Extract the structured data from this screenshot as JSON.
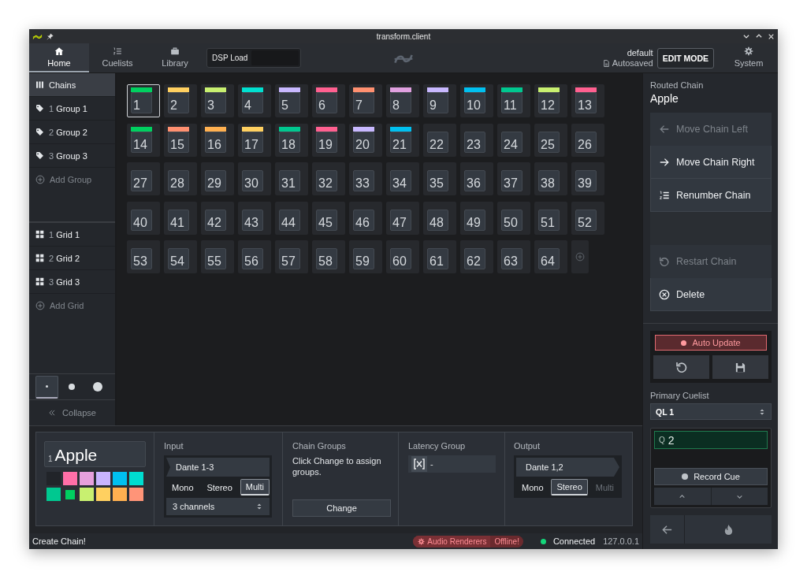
{
  "window": {
    "title": "transform.client"
  },
  "nav_tabs": [
    {
      "label": "Home",
      "selected": true
    },
    {
      "label": "Cuelists",
      "selected": false
    },
    {
      "label": "Library",
      "selected": false
    }
  ],
  "dsp_load": {
    "label": "DSP Load"
  },
  "show": {
    "name": "default",
    "status": "Autosaved"
  },
  "edit_mode_button": "EDIT MODE",
  "system_tab": {
    "label": "System",
    "selected": false
  },
  "sidebar": {
    "chains_item": {
      "label": "Chains",
      "selected": true
    },
    "groups": [
      {
        "number": "1",
        "label": "Group 1",
        "selected": false
      },
      {
        "number": "2",
        "label": "Group 2",
        "selected": false
      },
      {
        "number": "3",
        "label": "Group 3",
        "selected": false
      }
    ],
    "add_group": "Add Group",
    "grids": [
      {
        "number": "1",
        "label": "Grid 1",
        "selected": false
      },
      {
        "number": "2",
        "label": "Grid 2",
        "selected": false
      },
      {
        "number": "3",
        "label": "Grid 3",
        "selected": false
      }
    ],
    "add_grid": "Add Grid",
    "tile_sizes": [
      {
        "selected": true
      },
      {
        "selected": false
      },
      {
        "selected": false
      }
    ],
    "collapse": "Collapse"
  },
  "chains": [
    {
      "number": "1",
      "color": "#00d060",
      "selected": true
    },
    {
      "number": "2",
      "color": "#ffd060",
      "selected": false
    },
    {
      "number": "3",
      "color": "#c8f070",
      "selected": false
    },
    {
      "number": "4",
      "color": "#00e0d0",
      "selected": false
    },
    {
      "number": "5",
      "color": "#c8b8ff",
      "selected": false
    },
    {
      "number": "6",
      "color": "#ff6090",
      "selected": false
    },
    {
      "number": "7",
      "color": "#ff9070",
      "selected": false
    },
    {
      "number": "8",
      "color": "#e0a0e0",
      "selected": false
    },
    {
      "number": "9",
      "color": "#c8b8ff",
      "selected": false
    },
    {
      "number": "10",
      "color": "#00c0f0",
      "selected": false
    },
    {
      "number": "11",
      "color": "#00c890",
      "selected": false
    },
    {
      "number": "12",
      "color": "#c8f070",
      "selected": false
    },
    {
      "number": "13",
      "color": "#ff6090",
      "selected": false
    },
    {
      "number": "14",
      "color": "#00d060",
      "selected": false
    },
    {
      "number": "15",
      "color": "#ff9070",
      "selected": false
    },
    {
      "number": "16",
      "color": "#ffb050",
      "selected": false
    },
    {
      "number": "17",
      "color": "#ffd060",
      "selected": false
    },
    {
      "number": "18",
      "color": "#00c890",
      "selected": false
    },
    {
      "number": "19",
      "color": "#ff6090",
      "selected": false
    },
    {
      "number": "20",
      "color": "#c8b8ff",
      "selected": false
    },
    {
      "number": "21",
      "color": "#00c0f0",
      "selected": false
    },
    {
      "number": "22",
      "selected": false
    },
    {
      "number": "23",
      "selected": false
    },
    {
      "number": "24",
      "selected": false
    },
    {
      "number": "25",
      "selected": false
    },
    {
      "number": "26",
      "selected": false
    },
    {
      "number": "27",
      "selected": false
    },
    {
      "number": "28",
      "selected": false
    },
    {
      "number": "29",
      "selected": false
    },
    {
      "number": "30",
      "selected": false
    },
    {
      "number": "31",
      "selected": false
    },
    {
      "number": "32",
      "selected": false
    },
    {
      "number": "33",
      "selected": false
    },
    {
      "number": "34",
      "selected": false
    },
    {
      "number": "35",
      "selected": false
    },
    {
      "number": "36",
      "selected": false
    },
    {
      "number": "37",
      "selected": false
    },
    {
      "number": "38",
      "selected": false
    },
    {
      "number": "39",
      "selected": false
    },
    {
      "number": "40",
      "selected": false
    },
    {
      "number": "41",
      "selected": false
    },
    {
      "number": "42",
      "selected": false
    },
    {
      "number": "43",
      "selected": false
    },
    {
      "number": "44",
      "selected": false
    },
    {
      "number": "45",
      "selected": false
    },
    {
      "number": "46",
      "selected": false
    },
    {
      "number": "47",
      "selected": false
    },
    {
      "number": "48",
      "selected": false
    },
    {
      "number": "49",
      "selected": false
    },
    {
      "number": "50",
      "selected": false
    },
    {
      "number": "51",
      "selected": false
    },
    {
      "number": "52",
      "selected": false
    },
    {
      "number": "53",
      "selected": false
    },
    {
      "number": "54",
      "selected": false
    },
    {
      "number": "55",
      "selected": false
    },
    {
      "number": "56",
      "selected": false
    },
    {
      "number": "57",
      "selected": false
    },
    {
      "number": "58",
      "selected": false
    },
    {
      "number": "59",
      "selected": false
    },
    {
      "number": "60",
      "selected": false
    },
    {
      "number": "61",
      "selected": false
    },
    {
      "number": "62",
      "selected": false
    },
    {
      "number": "63",
      "selected": false
    },
    {
      "number": "64",
      "selected": false
    }
  ],
  "chain_editor": {
    "index": "1",
    "name": "Apple",
    "swatches": [
      {
        "kind": "none",
        "selected": false
      },
      {
        "kind": "color",
        "color": "#ff6fa8",
        "selected": false
      },
      {
        "kind": "color",
        "color": "#e6a0dc",
        "selected": false
      },
      {
        "kind": "color",
        "color": "#c8b4ff",
        "selected": false
      },
      {
        "kind": "color",
        "color": "#00c0f0",
        "selected": false
      },
      {
        "kind": "color",
        "color": "#00ddd0",
        "selected": false
      },
      {
        "kind": "color",
        "color": "#00c890",
        "selected": false
      },
      {
        "kind": "color",
        "color": "#00d060",
        "selected": true
      },
      {
        "kind": "color",
        "color": "#c8f070",
        "selected": false
      },
      {
        "kind": "color",
        "color": "#ffd060",
        "selected": false
      },
      {
        "kind": "color",
        "color": "#ffb050",
        "selected": false
      },
      {
        "kind": "color",
        "color": "#ff9478",
        "selected": false
      }
    ],
    "input": {
      "title": "Input",
      "route": "Dante 1-3",
      "modes": [
        {
          "label": "Mono",
          "selected": false,
          "disabled": false
        },
        {
          "label": "Stereo",
          "selected": false,
          "disabled": false
        },
        {
          "label": "Multi",
          "selected": true,
          "disabled": false
        }
      ],
      "channels": "3 channels"
    },
    "chain_groups": {
      "title": "Chain Groups",
      "hint": "Click Change to assign groups.",
      "button": "Change"
    },
    "latency_group": {
      "title": "Latency Group",
      "value": "-"
    },
    "output": {
      "title": "Output",
      "route": "Dante 1,2",
      "modes": [
        {
          "label": "Mono",
          "selected": false,
          "disabled": false
        },
        {
          "label": "Stereo",
          "selected": true,
          "disabled": false
        },
        {
          "label": "Multi",
          "selected": false,
          "disabled": true
        }
      ]
    }
  },
  "routed_chain": {
    "label": "Routed Chain",
    "name": "Apple",
    "move_actions": [
      {
        "label": "Move Chain Left",
        "disabled": true
      },
      {
        "label": "Move Chain Right",
        "disabled": false
      },
      {
        "label": "Renumber Chain",
        "disabled": false
      }
    ],
    "lifecycle_actions": [
      {
        "label": "Restart Chain",
        "disabled": true
      },
      {
        "label": "Delete",
        "disabled": false
      }
    ]
  },
  "auto_update": {
    "label": "Auto Update",
    "on": true
  },
  "primary_cuelist": {
    "label": "Primary Cuelist",
    "value": "QL 1"
  },
  "cue": {
    "prefix": "Q",
    "value": "2",
    "record_button": "Record Cue"
  },
  "status_bar": {
    "message": "Create Chain!",
    "renderers": {
      "label": "Audio Renderers",
      "state": "Offline!"
    },
    "connection": {
      "label": "Connected",
      "connected": true,
      "address": "127.0.0.1"
    }
  }
}
